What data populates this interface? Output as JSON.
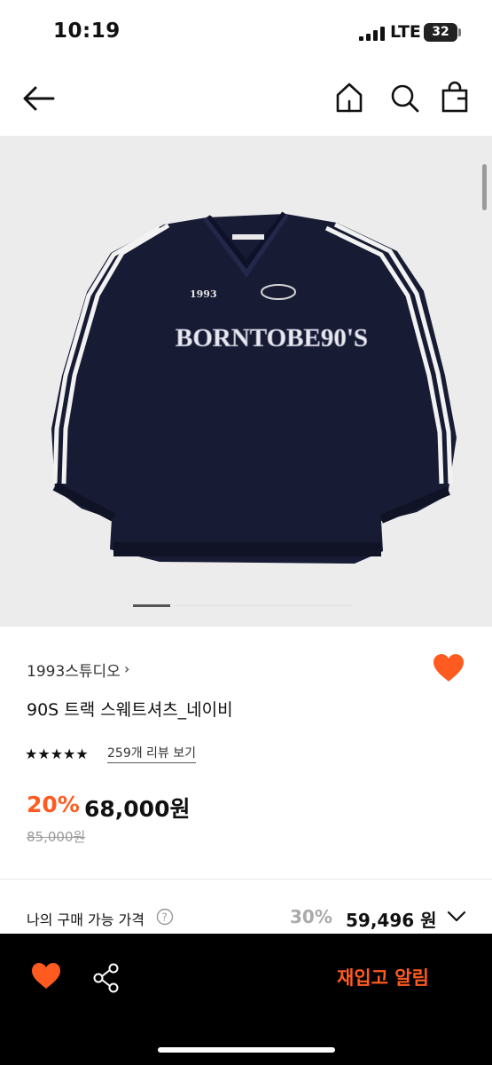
{
  "status_bar": {
    "time": "10:19",
    "network": "LTE",
    "battery": "32"
  },
  "header": {
    "back_icon": "arrow-left-icon",
    "home_icon": "home-icon",
    "search_icon": "search-icon",
    "bag_icon": "shopping-bag-icon"
  },
  "hero": {
    "image": "navy v-neck sweatshirt with white striped sleeves",
    "print_text": "BORNTOBE90'S",
    "print_small": "1993",
    "slide_count_visible": "1"
  },
  "product": {
    "brand": "1993스튜디오",
    "brand_chevron": "›",
    "title": "90S 트랙 스웨트셔츠_네이비",
    "stars": "★★★★★",
    "rating": 5,
    "review_link": "259개 리뷰 보기",
    "discount": "20%",
    "price": "68,000원",
    "original_price": "85,000원",
    "wishlist_icon": "heart-icon"
  },
  "purchase": {
    "label": "나의 구매 가능 가격",
    "help_icon": "question-circle-icon",
    "rate": "30%",
    "price": "59,496 원",
    "expand_icon": "chevron-down-icon"
  },
  "bottom_bar": {
    "heart_icon": "heart-icon",
    "share_icon": "share-icon",
    "restock_label": "재입고 알림"
  },
  "colors": {
    "accent": "#ff5a1f",
    "text": "#111111",
    "muted": "#999999",
    "hero_bg": "#ececec",
    "bottom_bar": "#000000"
  }
}
